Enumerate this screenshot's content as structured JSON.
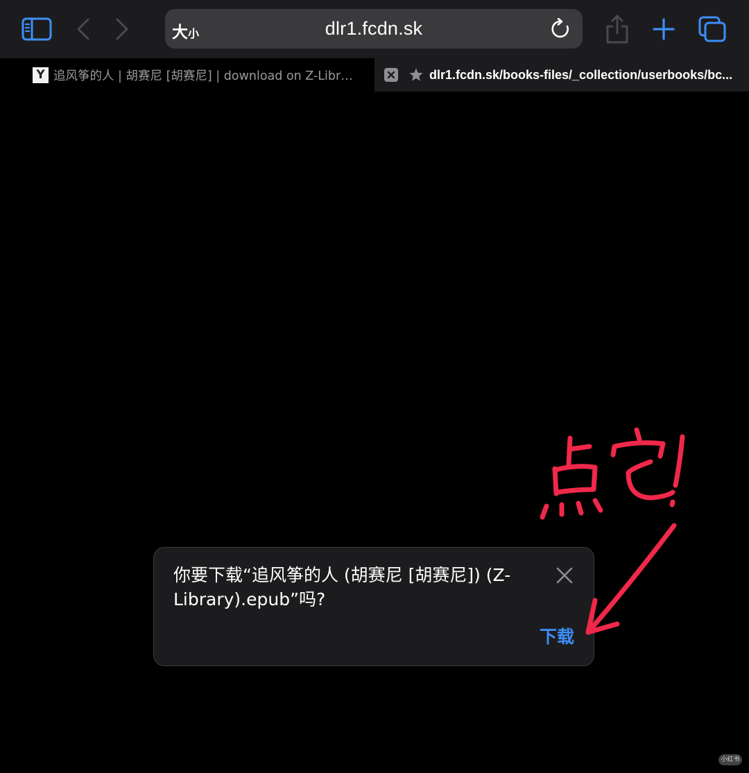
{
  "toolbar": {
    "address_bar": {
      "reader_size_large": "大",
      "reader_size_small": "小",
      "url": "dlr1.fcdn.sk"
    }
  },
  "tabs": [
    {
      "favicon_letter": "Y",
      "title": "追风筝的人 | 胡赛尼 [胡赛尼] | download on Z-Library",
      "active": false
    },
    {
      "title": "dlr1.fcdn.sk/books-files/_collection/userbooks/bc...",
      "active": true
    }
  ],
  "dialog": {
    "message": "你要下载“追风筝的人 (胡赛尼 [胡赛尼]) (Z-Library).epub”吗?",
    "download_label": "下载"
  },
  "annotation": {
    "text": "点它!",
    "color": "#f0284a"
  },
  "watermark": {
    "text": "小红书"
  },
  "colors": {
    "accent": "#3d8ef8",
    "toolbar_bg": "#1c1c1e",
    "address_bar_bg": "#3a3a3c",
    "page_bg": "#000000"
  },
  "icons": {
    "sidebar": "sidebar-icon",
    "back": "chevron-left-icon",
    "forward": "chevron-right-icon",
    "reload": "reload-icon",
    "share": "share-icon",
    "new_tab": "plus-icon",
    "tab_overview": "tabs-icon",
    "tab_close": "close-icon",
    "bookmark": "star-icon",
    "dialog_close": "close-icon"
  }
}
